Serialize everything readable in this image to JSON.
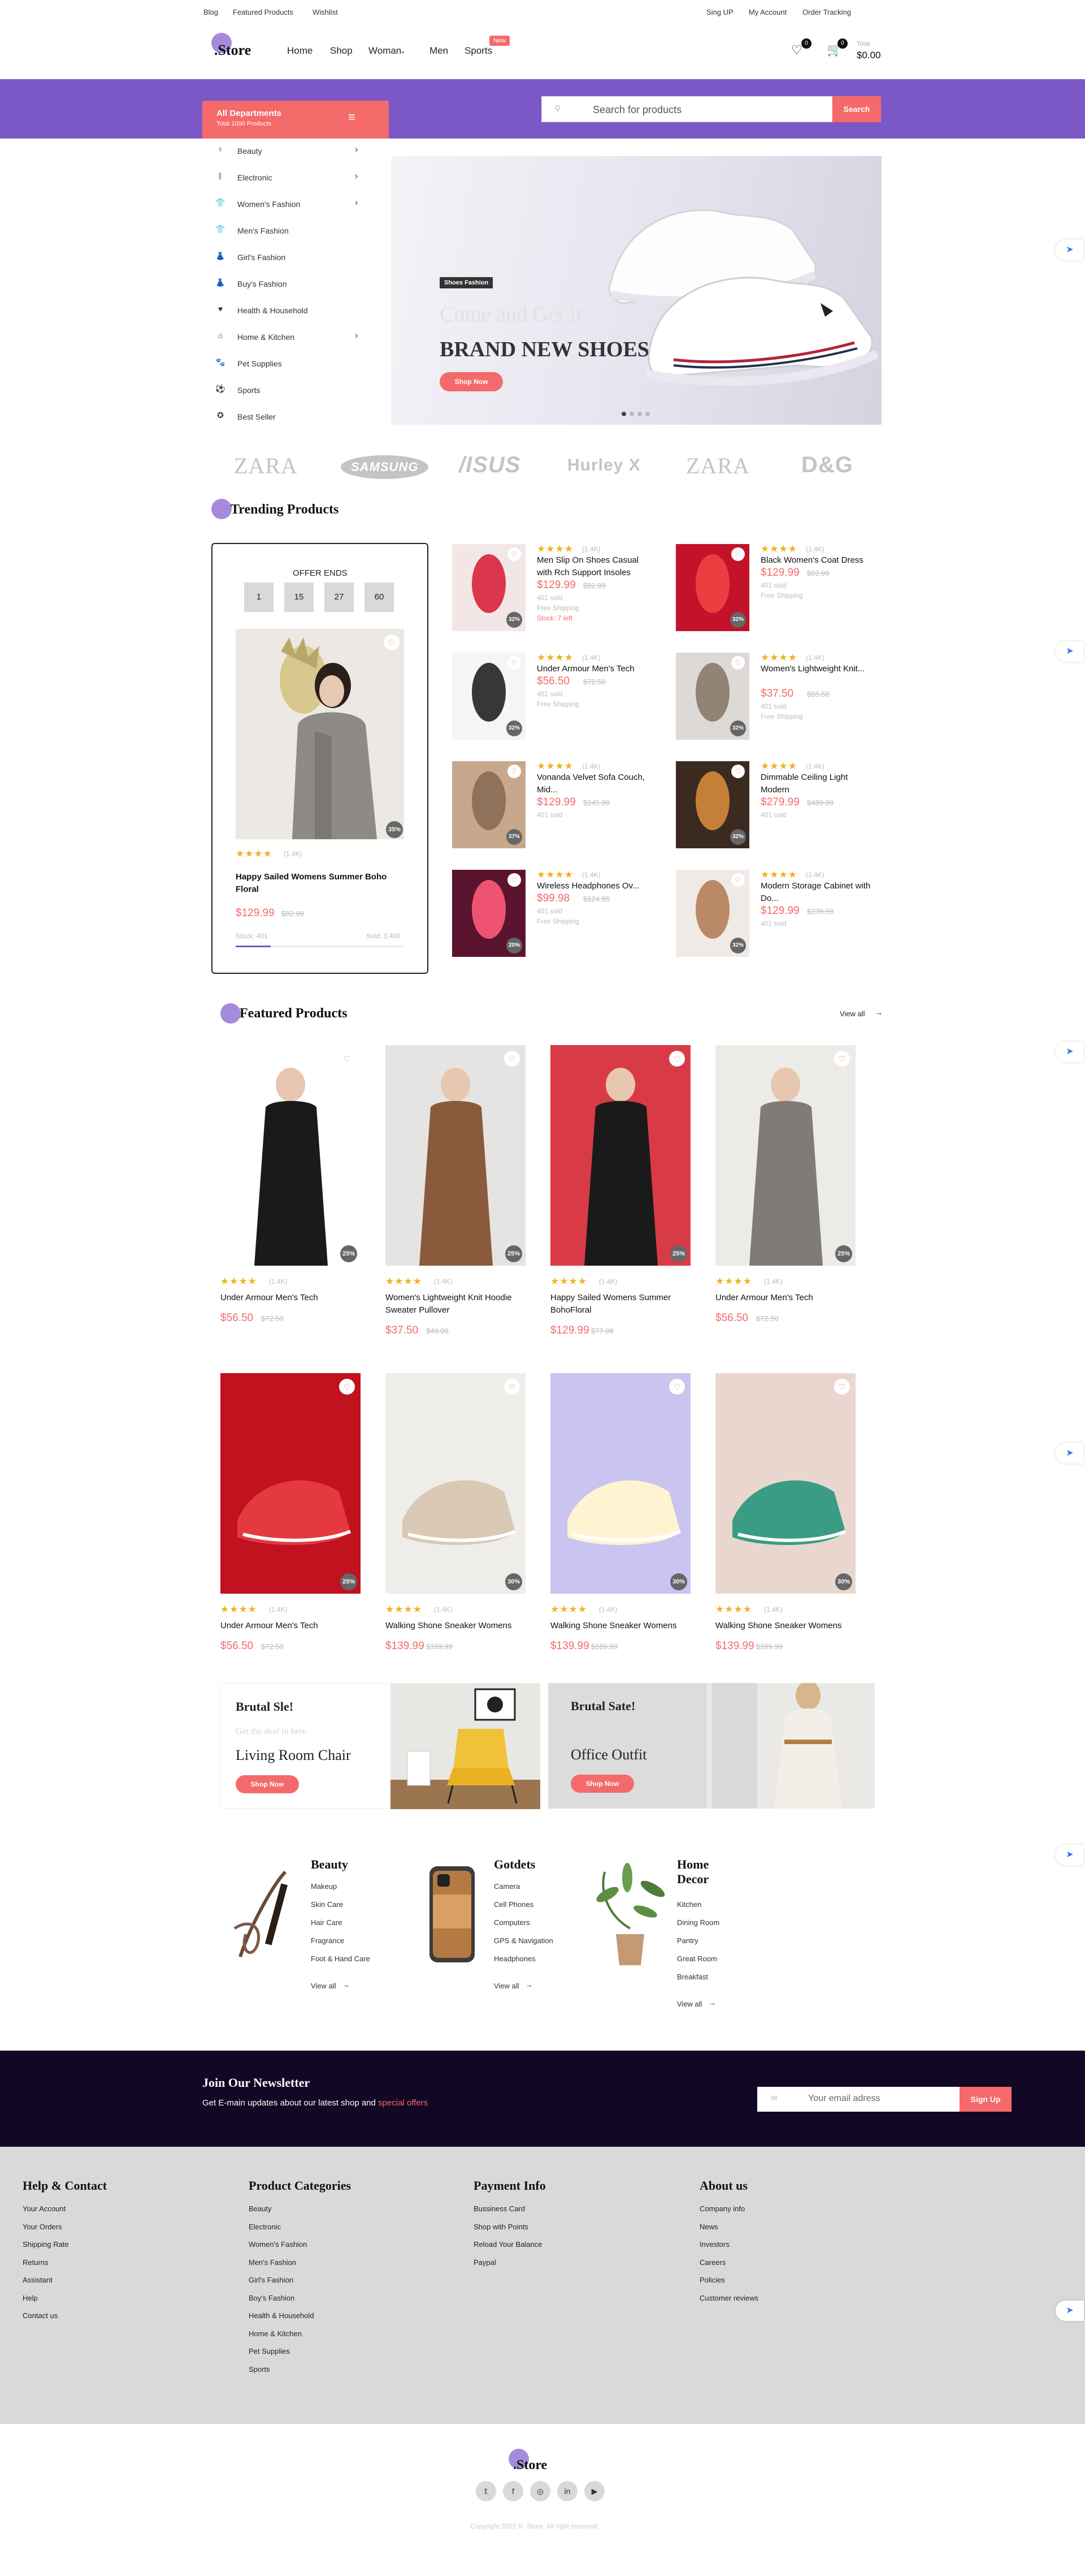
{
  "topbar": {
    "left": [
      "Blog",
      "Featured Products",
      "Wishlist"
    ],
    "right": [
      "Sing UP",
      "My Account",
      "Order Tracking"
    ]
  },
  "header": {
    "logo": ".Store",
    "nav": [
      "Home",
      "Shop",
      "Woman",
      "Men",
      "Sports"
    ],
    "new_badge": "New",
    "wishlist_count": "0",
    "cart_count": "0",
    "total_label": "Total",
    "total_value": "$0.00"
  },
  "departments": {
    "title": "All Departments",
    "subtitle": "Total 1000 Products",
    "items": [
      {
        "label": "Beauty",
        "icon": "beauty-icon",
        "has_children": true
      },
      {
        "label": "Electronic",
        "icon": "bluetooth-icon",
        "has_children": true
      },
      {
        "label": "Women's Fashion",
        "icon": "shirt-icon",
        "has_children": true
      },
      {
        "label": "Men's Fashion",
        "icon": "shirt-icon",
        "has_children": false
      },
      {
        "label": "Girl's Fashion",
        "icon": "dress-icon",
        "has_children": false
      },
      {
        "label": "Buy's Fashion",
        "icon": "dress-icon",
        "has_children": false
      },
      {
        "label": "Health & Household",
        "icon": "health-icon",
        "has_children": false
      },
      {
        "label": "Home & Kitchen",
        "icon": "home-icon",
        "has_children": true
      },
      {
        "label": "Pet Supplies",
        "icon": "pet-icon",
        "has_children": false
      },
      {
        "label": "Sports",
        "icon": "ball-icon",
        "has_children": false
      },
      {
        "label": "Best Seller",
        "icon": "badge-icon",
        "has_children": false
      }
    ]
  },
  "search": {
    "placeholder": "Search for products",
    "button": "Search"
  },
  "hero": {
    "tag": "Shoes Fashion",
    "ghost": "Come and Get It",
    "title": "BRAND NEW SHOES",
    "cta": "Shop Now"
  },
  "brands": [
    "ZARA",
    "SAMSUNG",
    "/ISUS",
    "Hurley X",
    "ZARA",
    "D&G"
  ],
  "trending": {
    "title": "Trending Products",
    "offer": {
      "label": "OFFER ENDS",
      "countdown": [
        "1",
        "15",
        "27",
        "60"
      ],
      "discount": "35%",
      "stars": "★★★★",
      "reviews": "(1.4K)",
      "name": "Happy Sailed Womens Summer Boho Floral",
      "price": "$129.99",
      "old_price": "$82.99",
      "stock": "Stock: 401",
      "sold": "Sold: 3,400"
    },
    "items": [
      {
        "name": "Men Slip On Shoes Casual with Rch Support Insoles",
        "stars": "★★★★",
        "reviews": "(1.4K)",
        "price": "$129.99",
        "old": "$82.99",
        "sold": "401 sold",
        "ship": "Free Shipping",
        "stock": "Stock: 7 left",
        "disc": "32%"
      },
      {
        "name": "Black Women's Coat Dress",
        "stars": "★★★★",
        "reviews": "(1.4K)",
        "price": "$129.99",
        "old": "$82.99",
        "sold": "401 sold",
        "ship": "Free Shipping",
        "stock": "",
        "disc": "32%"
      },
      {
        "name": "Under Armour Men's Tech",
        "stars": "★★★★",
        "reviews": "(1.4K)",
        "price": "$56.50",
        "old": "$72.50",
        "sold": "401 sold",
        "ship": "Free Shipping",
        "stock": "",
        "disc": "32%"
      },
      {
        "name": "Women's Lightweight Knit...",
        "stars": "★★★★",
        "reviews": "(1.4K)",
        "price": "$37.50",
        "old": "$55.50",
        "sold": "401 sold",
        "ship": "Free Shipping",
        "stock": "",
        "disc": "32%"
      },
      {
        "name": "Vonanda Velvet Sofa Couch, Mid...",
        "stars": "★★★★",
        "reviews": "(1.4K)",
        "price": "$129.99",
        "old": "$245.99",
        "sold": "401 sold",
        "ship": "",
        "stock": "",
        "disc": "37%"
      },
      {
        "name": "Dimmable Ceiling Light Modern",
        "stars": "★★★★",
        "reviews": "(1.4K)",
        "price": "$279.99",
        "old": "$489.99",
        "sold": "401 sold",
        "ship": "",
        "stock": "",
        "disc": "32%"
      },
      {
        "name": "Wireless Headphones Ov...",
        "stars": "★★★★",
        "reviews": "(1.4K)",
        "price": "$99.98",
        "old": "$124.95",
        "sold": "401 sold",
        "ship": "Free Shipping",
        "stock": "",
        "disc": "20%"
      },
      {
        "name": "Modern Storage Cabinet with Do...",
        "stars": "★★★★",
        "reviews": "(1.4K)",
        "price": "$129.99",
        "old": "$239.99",
        "sold": "401 sold",
        "ship": "",
        "stock": "",
        "disc": "32%"
      }
    ]
  },
  "featured": {
    "title": "Featured Products",
    "view_all": "View all",
    "items": [
      {
        "name": "Under Armour Men's Tech",
        "stars": "★★★★",
        "reviews": "(1.4K)",
        "price": "$56.50",
        "old": "$72.50",
        "disc": "25%"
      },
      {
        "name": "Women's Lightweight Knit Hoodie Sweater Pullover",
        "stars": "★★★★",
        "reviews": "(1.4K)",
        "price": "$37.50",
        "old": "$49.00",
        "disc": "25%"
      },
      {
        "name": "Happy Sailed Womens Summer BohoFloral",
        "stars": "★★★★",
        "reviews": "(1.4K)",
        "price": "$129.99",
        "old": "$77.99",
        "disc": "25%"
      },
      {
        "name": "Under Armour Men's Tech",
        "stars": "★★★★",
        "reviews": "(1.4K)",
        "price": "$56.50",
        "old": "$72.50",
        "disc": "25%"
      },
      {
        "name": "Under Armour Men's Tech",
        "stars": "★★★★",
        "reviews": "(1.4K)",
        "price": "$56.50",
        "old": "$72.50",
        "disc": "25%"
      },
      {
        "name": "Walking Shone Sneaker Womens",
        "stars": "★★★★",
        "reviews": "(1.4K)",
        "price": "$139.99",
        "old": "$189.99",
        "disc": "30%"
      },
      {
        "name": "Walking Shone Sneaker Womens",
        "stars": "★★★★",
        "reviews": "(1.4K)",
        "price": "$139.99",
        "old": "$189.99",
        "disc": "30%"
      },
      {
        "name": "Walking Shone Sneaker Womens",
        "stars": "★★★★",
        "reviews": "(1.4K)",
        "price": "$139.99",
        "old": "$189.99",
        "disc": "30%"
      }
    ]
  },
  "promos": [
    {
      "title": "Brutal Sle!",
      "ghost": "Get the deal in here",
      "subtitle": "Living Room Chair",
      "cta": "Shop Now"
    },
    {
      "title": "Brutal Sate!",
      "ghost": "",
      "subtitle": "Office Outfit",
      "cta": "Shop Now"
    }
  ],
  "categories": [
    {
      "title": "Beauty",
      "items": [
        "Makeup",
        "Skin Care",
        "Hair Care",
        "Fragrance",
        "Foot & Hand Care"
      ],
      "view_all": "View all"
    },
    {
      "title": "Gotdets",
      "items": [
        "Camera",
        "Cell Phones",
        "Computers",
        "GPS & Navigation",
        "Headphones"
      ],
      "view_all": "View all"
    },
    {
      "title": "Home Decor",
      "items": [
        "Kitchen",
        "Dining Room",
        "Pantry",
        "Great Room",
        "Breakfast"
      ],
      "view_all": "View all"
    }
  ],
  "newsletter": {
    "title": "Join Our Newsletter",
    "text": "Get E-main updates about our latest shop and",
    "highlight": "special offers",
    "placeholder": "Your email adress",
    "button": "Sign Up"
  },
  "footer": {
    "cols": [
      {
        "title": "Help & Contact",
        "items": [
          "Your Account",
          "Your Orders",
          "Shipping Rate",
          "Returns",
          "Assistant",
          "Help",
          "Contact us"
        ]
      },
      {
        "title": "Product Categories",
        "items": [
          "Beauty",
          "Electronic",
          "Women's Fashion",
          "Men's Fashion",
          "Girl's Fashion",
          "Boy's Fashion",
          "Health & Household",
          "Home & Kitchen",
          "Pet Supplies",
          "Sports"
        ]
      },
      {
        "title": "Payment Info",
        "items": [
          "Bussiness Card",
          "Shop with Points",
          "Reload Your Balance",
          "Paypal"
        ]
      },
      {
        "title": "About us",
        "items": [
          "Company info",
          "News",
          "Investors",
          "Careers",
          "Policies",
          "Customer reviews"
        ]
      }
    ],
    "logo": ".Store",
    "social": [
      "twitter-icon",
      "facebook-icon",
      "instagram-icon",
      "linkedin-icon",
      "youtube-icon"
    ],
    "copyright": "Copyright 2022 © .Store. All right reserved"
  },
  "colors": {
    "accent": "#f46a6a",
    "purple": "#7b58c6",
    "dark": "#120724",
    "footer": "#d9d9d9",
    "star": "#f2b01e"
  }
}
